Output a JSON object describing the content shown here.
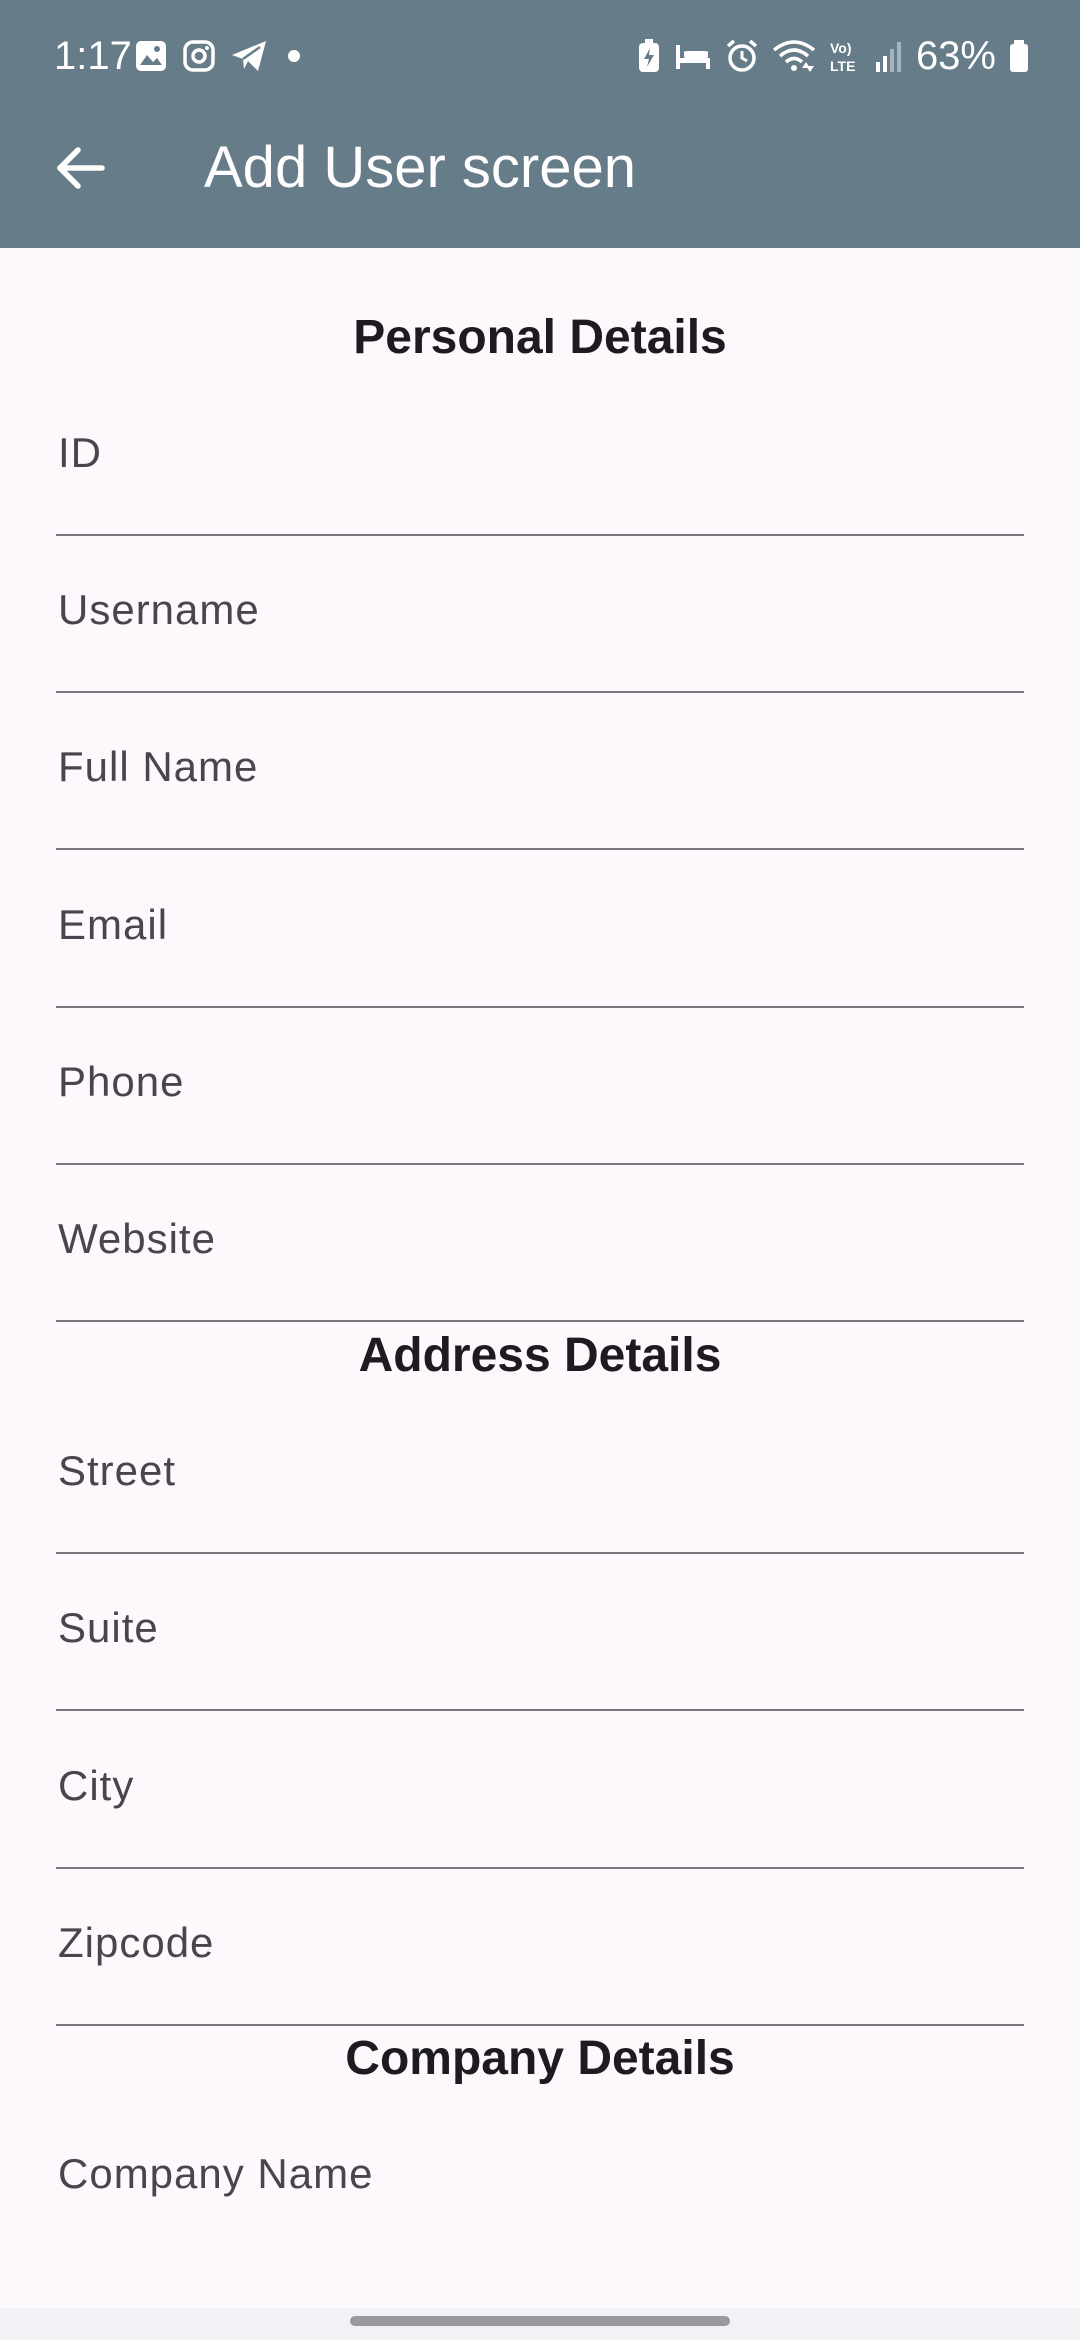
{
  "status_bar": {
    "time": "1:17",
    "battery": "63%"
  },
  "app_bar": {
    "title": "Add User screen"
  },
  "sections": {
    "personal": {
      "title": "Personal Details",
      "fields": [
        "ID",
        "Username",
        "Full Name",
        "Email",
        "Phone",
        "Website"
      ]
    },
    "address": {
      "title": "Address Details",
      "fields": [
        "Street",
        "Suite",
        "City",
        "Zipcode"
      ]
    },
    "company": {
      "title": "Company Details",
      "fields": [
        "Company Name"
      ]
    }
  },
  "colors": {
    "app_bar": "#667c89",
    "background": "#fcf8fc",
    "underline": "#7a7680",
    "label": "#49454f"
  },
  "icons": {
    "back": "arrow-left-icon"
  }
}
